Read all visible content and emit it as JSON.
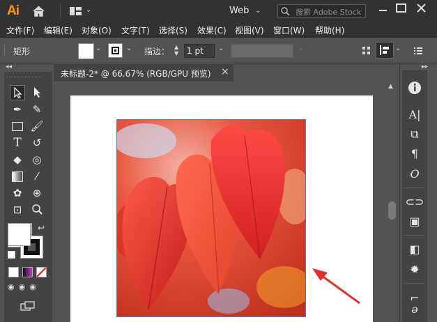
{
  "titlebar": {
    "app_logo": "Ai",
    "workspace": "Web",
    "search_placeholder": "搜索 Adobe Stock",
    "icons": [
      "home-icon",
      "arrange-documents-icon",
      "search-icon",
      "minimize-icon",
      "maximize-icon",
      "close-icon"
    ]
  },
  "menu": {
    "items": [
      "文件(F)",
      "编辑(E)",
      "对象(O)",
      "文字(T)",
      "选择(S)",
      "效果(C)",
      "视图(V)",
      "窗口(W)",
      "帮助(H)"
    ]
  },
  "control_bar": {
    "selection_label": "矩形",
    "fill_color": "#ffffff",
    "stroke_label": "描边：",
    "stroke_value": "1 pt"
  },
  "document": {
    "tab_title": "未标题-2* @ 66.67% (RGB/GPU 预览)",
    "tab_close": "×"
  },
  "colors": {
    "ui_dark": "#323232",
    "ui_mid": "#535353",
    "panel": "#434343",
    "selection_blue": "#4b7bd6",
    "arrow_red": "#e0302a",
    "logo_orange": "#ff9a00"
  },
  "right_panel": {
    "icons": [
      "info-icon",
      "character-icon",
      "paragraph-styles-icon",
      "paragraph-icon",
      "opentype-icon",
      "links-icon",
      "layers-icon",
      "pathfinder-icon",
      "appearance-icon",
      "transform-icon"
    ]
  }
}
